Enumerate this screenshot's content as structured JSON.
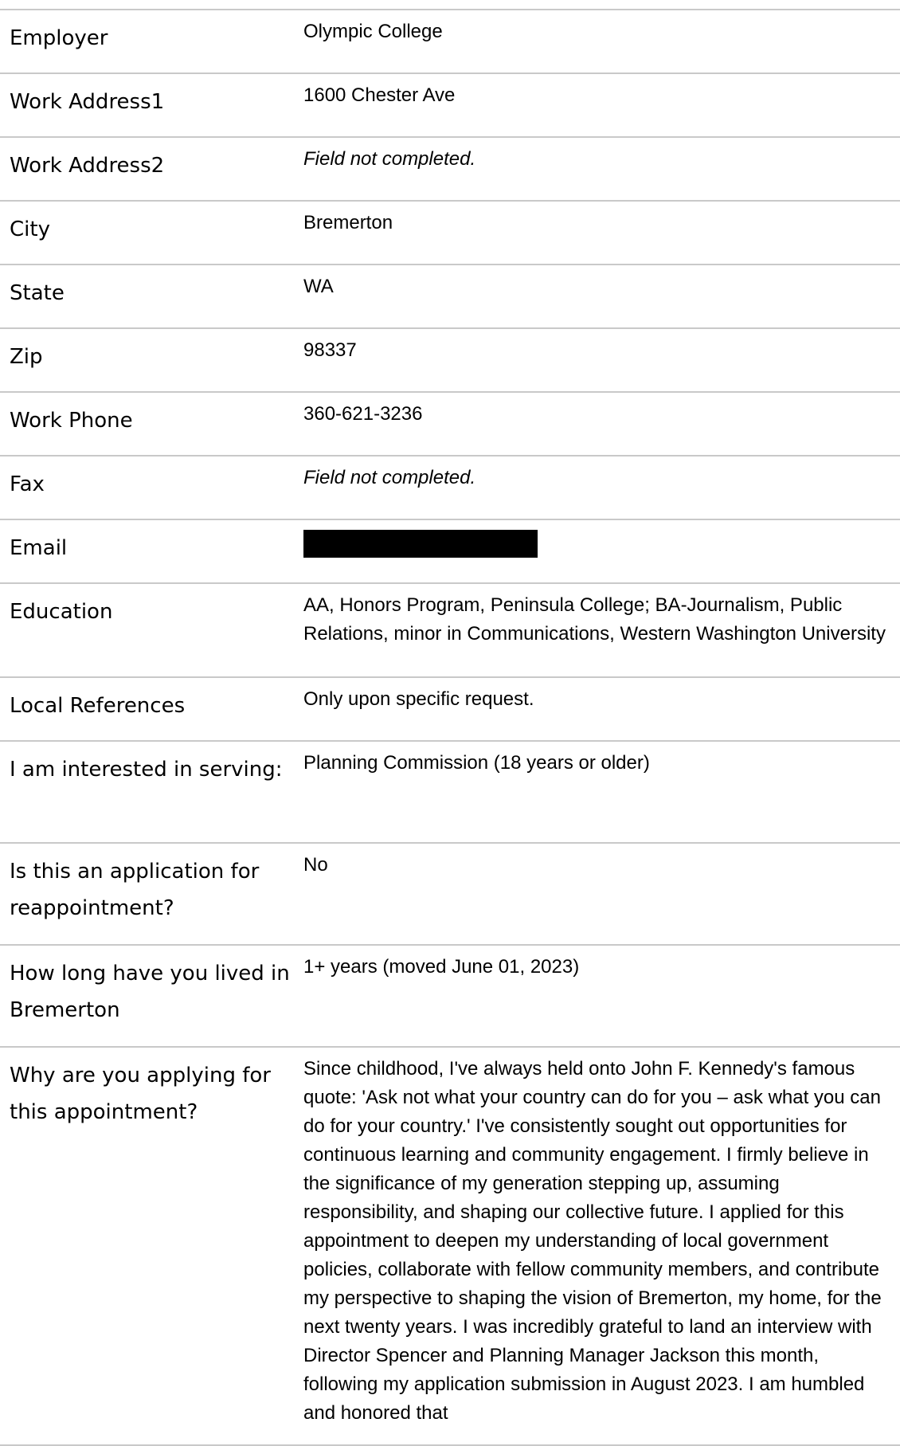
{
  "rows": [
    {
      "label": "Employer",
      "value": "Olympic College",
      "height": 80
    },
    {
      "label": "Work Address1",
      "value": "1600 Chester Ave",
      "height": 80
    },
    {
      "label": "Work Address2",
      "value": "Field not completed.",
      "empty": true,
      "height": 80
    },
    {
      "label": "City",
      "value": "Bremerton",
      "height": 80
    },
    {
      "label": "State",
      "value": "WA",
      "height": 80
    },
    {
      "label": "Zip",
      "value": "98337",
      "height": 80
    },
    {
      "label": "Work Phone",
      "value": "360-621-3236",
      "height": 80
    },
    {
      "label": "Fax",
      "value": "Field not completed.",
      "empty": true,
      "height": 80
    },
    {
      "label": "Email",
      "redacted": true,
      "height": 80
    },
    {
      "label": "Education",
      "value": "AA, Honors Program, Peninsula College; BA-Journalism, Public Relations, minor in Communications, Western Washington University",
      "height": 118
    },
    {
      "label": "Local References",
      "value": "Only upon specific request.",
      "height": 80
    },
    {
      "label": "I am interested in serving:",
      "value": "Planning Commission (18 years or older)",
      "height": 128
    },
    {
      "label": "Is this an application for reappointment?",
      "value": "No",
      "height": 128
    },
    {
      "label": "How long have you lived in Bremerton",
      "value": "1+ years (moved June 01, 2023)",
      "height": 128
    },
    {
      "label": "Why are you applying for this appointment?",
      "value": "Since childhood, I've always held onto John F. Kennedy's famous quote: 'Ask not what your country can do for you – ask what you can do for your country.' I've consistently sought out opportunities for continuous learning and community engagement. I firmly believe in the significance of my generation stepping up, assuming responsibility, and shaping our collective future. I applied for this appointment to deepen my understanding of local government policies, collaborate with fellow community members, and contribute my perspective to shaping the vision of Bremerton, my home, for the next twenty years. I was incredibly grateful to land an interview with Director Spencer and Planning Manager Jackson this month, following my application submission in August 2023. I am humbled and honored that",
      "height": 500
    }
  ]
}
